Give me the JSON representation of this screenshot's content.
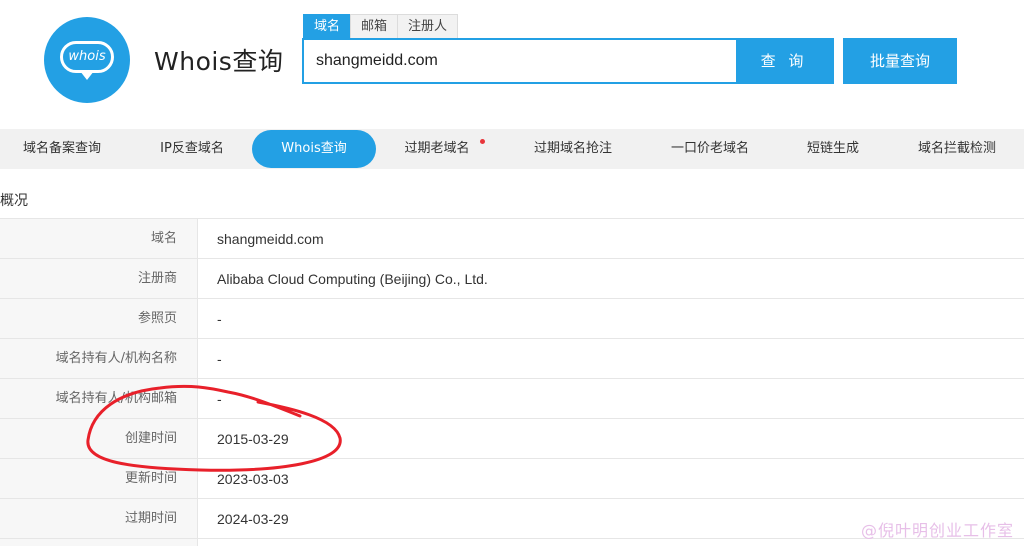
{
  "header": {
    "logo_text": "whois",
    "site_title": "Whois查询"
  },
  "search": {
    "tabs": [
      {
        "label": "域名",
        "active": true
      },
      {
        "label": "邮箱",
        "active": false
      },
      {
        "label": "注册人",
        "active": false
      }
    ],
    "value": "shangmeidd.com",
    "query_button": "查 询",
    "bulk_button": "批量查询"
  },
  "nav": {
    "items": [
      {
        "label": "域名备案查询"
      },
      {
        "label": "IP反查域名"
      },
      {
        "label": "Whois查询",
        "active": true
      },
      {
        "label": "过期老域名",
        "dot": true
      },
      {
        "label": "过期域名抢注"
      },
      {
        "label": "一口价老域名"
      },
      {
        "label": "短链生成"
      },
      {
        "label": "域名拦截检测"
      }
    ]
  },
  "overview": {
    "title": "概况",
    "rows": [
      {
        "label": "域名",
        "value": "shangmeidd.com"
      },
      {
        "label": "注册商",
        "value": "Alibaba Cloud Computing (Beijing) Co., Ltd."
      },
      {
        "label": "参照页",
        "value": "-"
      },
      {
        "label": "域名持有人/机构名称",
        "value": "-"
      },
      {
        "label": "域名持有人/机构邮箱",
        "value": "-"
      },
      {
        "label": "创建时间",
        "value": "2015-03-29"
      },
      {
        "label": "更新时间",
        "value": "2023-03-03"
      },
      {
        "label": "过期时间",
        "value": "2024-03-29"
      }
    ]
  },
  "watermark": "@倪叶明创业工作室",
  "colors": {
    "accent": "#23a0e4",
    "annotation": "#e8202a",
    "nav_dot": "#e8353a"
  }
}
